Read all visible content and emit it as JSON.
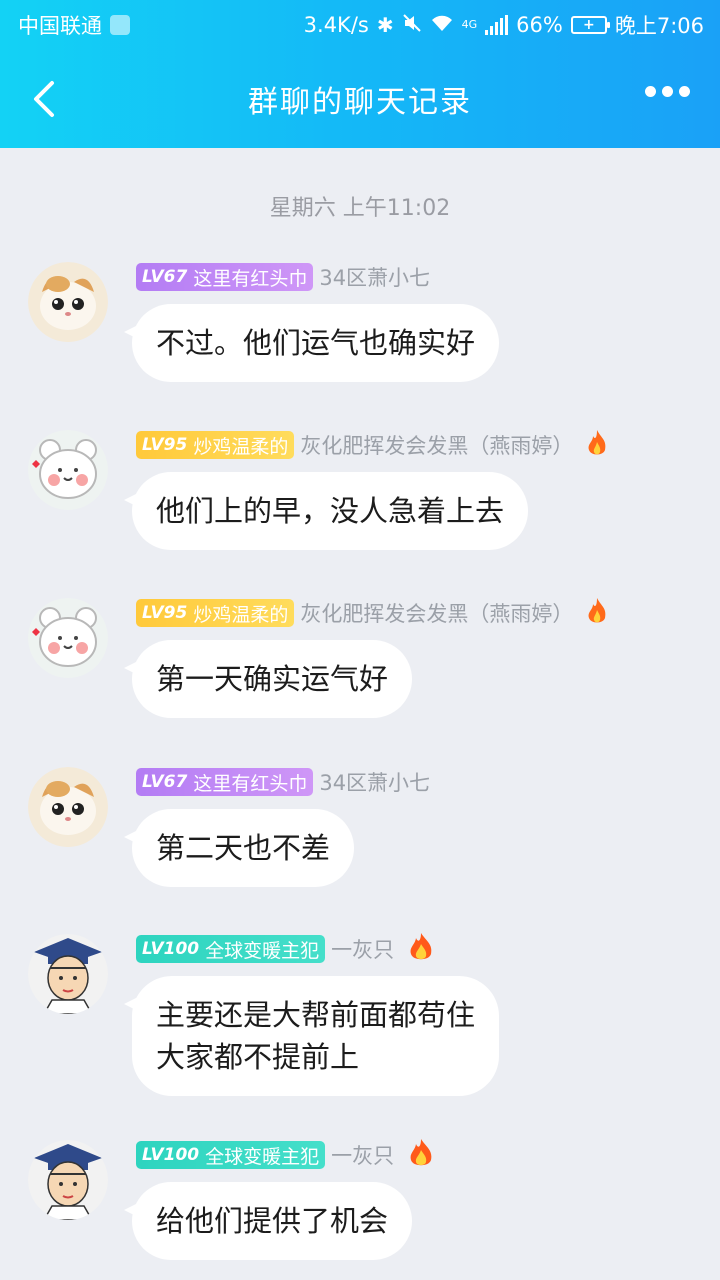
{
  "status": {
    "carrier": "中国联通",
    "speed": "3.4K/s",
    "network": "4G",
    "battery": "66%",
    "battery_level": 66,
    "time": "晚上7:06"
  },
  "nav": {
    "title": "群聊的聊天记录"
  },
  "timestamp": "星期六 上午11:02",
  "messages": [
    {
      "avatar": "cat-avatar",
      "level": "LV67",
      "title": "这里有红头巾",
      "badge_color": "purple",
      "sender": "34区萧小七",
      "fire": false,
      "text": [
        "不过。他们运气也确实好"
      ]
    },
    {
      "avatar": "bear-avatar",
      "level": "LV95",
      "title": "炒鸡温柔的",
      "badge_color": "yellow",
      "sender": "灰化肥挥发会发黑（燕雨婷）",
      "fire": true,
      "text": [
        "他们上的早，没人急着上去"
      ]
    },
    {
      "avatar": "bear-avatar",
      "level": "LV95",
      "title": "炒鸡温柔的",
      "badge_color": "yellow",
      "sender": "灰化肥挥发会发黑（燕雨婷）",
      "fire": true,
      "text": [
        "第一天确实运气好"
      ]
    },
    {
      "avatar": "cat-avatar",
      "level": "LV67",
      "title": "这里有红头巾",
      "badge_color": "purple",
      "sender": "34区萧小七",
      "fire": false,
      "text": [
        "第二天也不差"
      ]
    },
    {
      "avatar": "student-avatar",
      "level": "LV100",
      "title": "全球变暖主犯",
      "badge_color": "teal",
      "sender": "一灰只",
      "fire": true,
      "text": [
        "主要还是大帮前面都苟住",
        "大家都不提前上"
      ]
    },
    {
      "avatar": "student-avatar",
      "level": "LV100",
      "title": "全球变暖主犯",
      "badge_color": "teal",
      "sender": "一灰只",
      "fire": true,
      "text": [
        "给他们提供了机会"
      ]
    }
  ],
  "colors": {
    "header_start": "#13d2f5",
    "header_end": "#1aa1f7",
    "background": "#eceef3"
  }
}
